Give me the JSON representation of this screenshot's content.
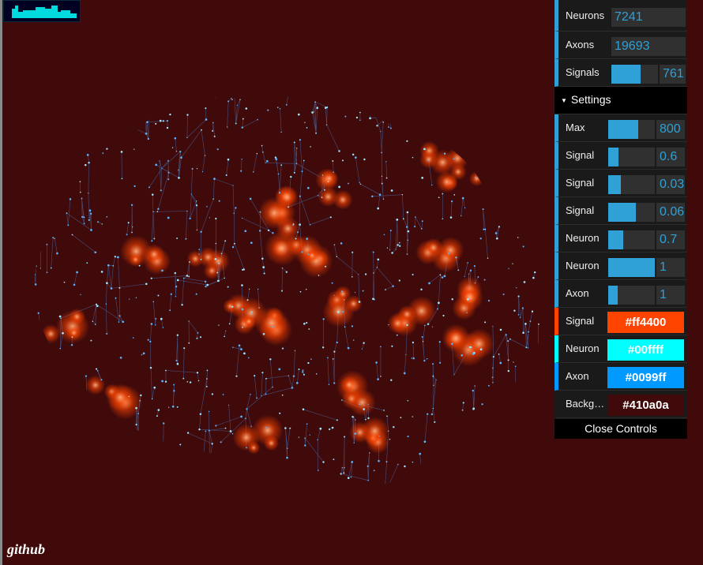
{
  "link": {
    "label": "github"
  },
  "controls": {
    "stats": [
      {
        "label": "Neurons",
        "value": "7241"
      },
      {
        "label": "Axons",
        "value": "19693"
      },
      {
        "label": "Signals",
        "value": "761",
        "fill": 0.63
      }
    ],
    "folder_label": "Settings",
    "settings": [
      {
        "label": "Max",
        "value": "800",
        "fill": 0.65
      },
      {
        "label": "Signal",
        "value": "0.6",
        "fill": 0.22
      },
      {
        "label": "Signal",
        "value": "0.03",
        "fill": 0.27
      },
      {
        "label": "Signal",
        "value": "0.06",
        "fill": 0.6
      },
      {
        "label": "Neuron",
        "value": "0.7",
        "fill": 0.33
      },
      {
        "label": "Neuron",
        "value": "1",
        "fill": 1.0
      },
      {
        "label": "Axon",
        "value": "1",
        "fill": 0.2
      }
    ],
    "colors": [
      {
        "label": "Signal",
        "value": "#ff4400",
        "swatch": "#ff4400",
        "text_color": "#ffffff"
      },
      {
        "label": "Neuron",
        "value": "#00ffff",
        "swatch": "#00ffff",
        "text_color": "#ffffff"
      },
      {
        "label": "Axon",
        "value": "#0099ff",
        "swatch": "#0099ff",
        "text_color": "#ffffff"
      },
      {
        "label": "Background",
        "value": "#410a0a",
        "swatch": "#410a0a",
        "text_color": "#ffffff"
      }
    ],
    "close_label": "Close Controls"
  },
  "theme": {
    "background": "#410a0a",
    "panel_accent": "#2fa1d6",
    "signal_color": "#ff4400",
    "neuron_color": "#00ffff",
    "axon_color": "#0099ff"
  }
}
